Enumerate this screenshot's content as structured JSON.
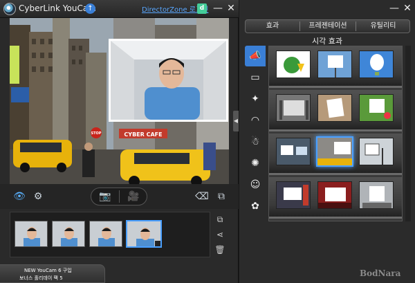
{
  "app": {
    "title": "CyberLink YouCam",
    "directorzone_link": "DirectorZone 로그인",
    "directorzone_badge": "d"
  },
  "camera": {
    "signs": [
      "CYBER CAFE",
      "STOP"
    ]
  },
  "toolbar": {
    "effects_icon": "eye-icon",
    "settings_icon": "gear-icon",
    "snapshot_icon": "camera-icon",
    "record_icon": "video-icon",
    "eraser_icon": "eraser-icon",
    "screen_icon": "window-icon"
  },
  "thumbnails": [
    {
      "label": "thumbnail-1",
      "selected": false
    },
    {
      "label": "thumbnail-2",
      "selected": false
    },
    {
      "label": "thumbnail-3",
      "selected": false
    },
    {
      "label": "thumbnail-4",
      "selected": true
    }
  ],
  "promo": {
    "line1": "NEW YouCam 6 구입",
    "line2": "보너스 홀리데이 팩 5"
  },
  "effects_panel": {
    "tabs": [
      {
        "label": "효과"
      },
      {
        "label": "프레젠테이션"
      },
      {
        "label": "유틸리티"
      }
    ],
    "section_title": "시각 효과",
    "categories": [
      "scene-icon",
      "frame-icon",
      "magic-wand-icon",
      "mask-icon",
      "avatar-icon",
      "emotion-icon",
      "smiley-icon",
      "gadget-icon"
    ]
  },
  "watermark": "BodNara"
}
